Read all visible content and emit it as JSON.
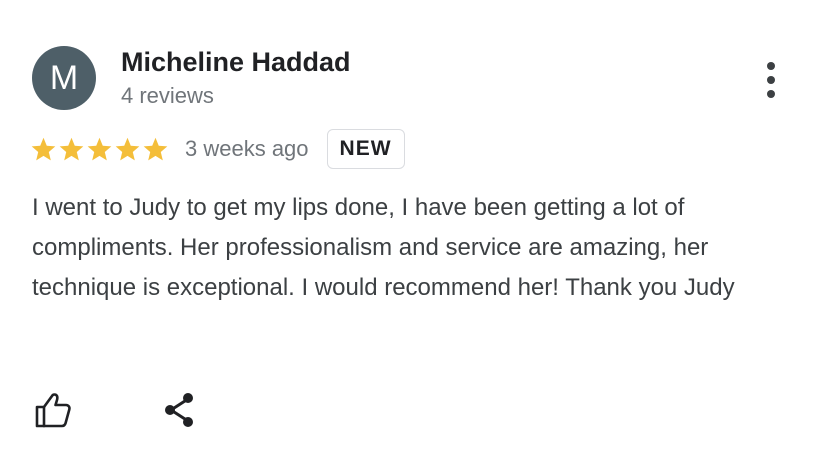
{
  "review": {
    "avatar_letter": "M",
    "reviewer_name": "Micheline Haddad",
    "review_count": "4 reviews",
    "rating": 5,
    "rating_max": 5,
    "date": "3 weeks ago",
    "badge": "NEW",
    "text": "I went to Judy to get my lips done, I have been getting a lot of compliments. Her professionalism and service are amazing, her technique is exceptional. I would recommend her! Thank you Judy"
  },
  "icons": {
    "more": "more-vert-icon",
    "star": "star-icon",
    "like": "thumb-up-icon",
    "share": "share-icon"
  },
  "colors": {
    "avatar_bg": "#4e5f68",
    "star": "#f4be3a",
    "secondary_text": "#70757a",
    "body_text": "#3c4043",
    "badge_border": "#dadce0"
  }
}
